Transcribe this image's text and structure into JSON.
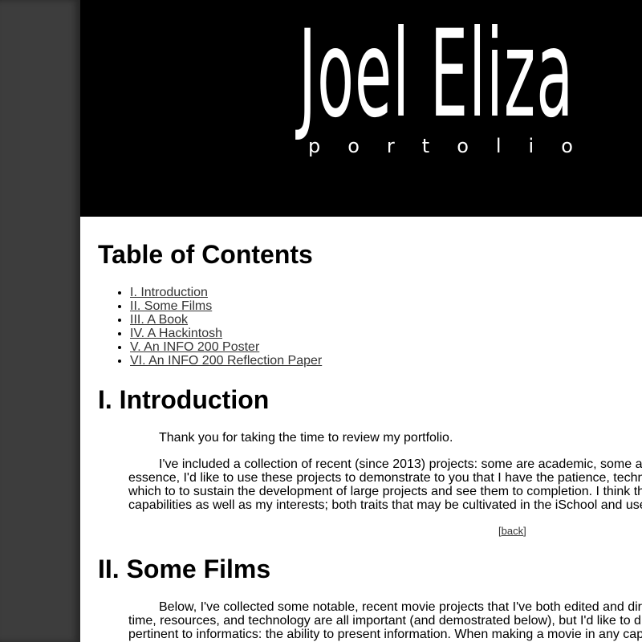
{
  "banner": {
    "title": "Joel Eliza",
    "subtitle": "portolio"
  },
  "toc": {
    "heading": "Table of Contents",
    "items": [
      "I. Introduction",
      "II. Some Films",
      "III. A Book",
      "IV. A Hackintosh",
      "V. An INFO 200 Poster",
      "VI. An INFO 200 Reflection Paper"
    ]
  },
  "introduction": {
    "heading": "I. Introduction",
    "paragraph1": "Thank you for taking the time to review my portfolio.",
    "paragraph2_lines": [
      "I've included a collection of recent (since 2013) projects: some are academic, some ar",
      "essence, I'd like to use these projects to demonstrate to you that I have the patience, technic",
      "which to to sustain the development of large projects and see them to completion. I think tha",
      "capabilities as well as my interests; both traits that may be cultivated in the iSchool and use"
    ],
    "back_open": "[",
    "back_label": "back",
    "back_close": "]"
  },
  "films": {
    "heading": "II. Some Films",
    "paragraph_lines": [
      "Below, I've collected some notable, recent movie projects that I've both edited and dire",
      "time, resources, and technology are all important (and demostrated below), but I'd like to div",
      "pertinent to informatics: the ability to present information. When making a movie in any capa"
    ]
  }
}
